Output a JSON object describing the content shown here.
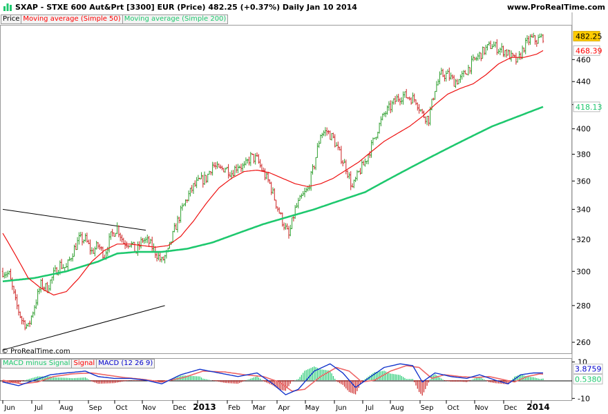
{
  "header": {
    "title": "SXAP - STXE 600 Aut&Prt [3300] EUR (Price)     482.25 (+0.37%)     Daily  Jan 10 2014",
    "site": "www.ProRealTime.com"
  },
  "copyright": "© ProRealTime.com",
  "price_legend": [
    {
      "label": "Price",
      "color": "#000000"
    },
    {
      "label": "Moving average (Simple 50)",
      "color": "#ff0000"
    },
    {
      "label": "Moving average (Simple 200)",
      "color": "#1ec86e"
    }
  ],
  "macd_legend": [
    {
      "label": "MACD minus Signal",
      "color": "#1ec86e"
    },
    {
      "label": "Signal",
      "color": "#ff0000"
    },
    {
      "label": "MACD (12 26 9)",
      "color": "#0000cc"
    }
  ],
  "chart_data": [
    {
      "type": "line",
      "subtype": "ohlc",
      "y_scale": "log",
      "ylim": [
        255,
        492
      ],
      "yticks": [
        260,
        280,
        300,
        320,
        340,
        360,
        380,
        400,
        420,
        440,
        460
      ],
      "x_labels": [
        "Jun",
        "Jul",
        "Aug",
        "Sep",
        "Oct",
        "Nov",
        "Dec",
        "2013",
        "Feb",
        "Mar",
        "Apr",
        "May",
        "Jun",
        "Jul",
        "Aug",
        "Sep",
        "Oct",
        "Nov",
        "Dec",
        "2014"
      ],
      "bold_x_labels": [
        "2013",
        "2014"
      ],
      "value_tags": [
        {
          "name": "Price",
          "value": "482.25",
          "bg": "#ffcc00",
          "fg": "#000000"
        },
        {
          "name": "Moving average (Simple 50)",
          "value": "468.39",
          "bg": "#ffffff",
          "fg": "#ff0000"
        },
        {
          "name": "Moving average (Simple 200)",
          "value": "418.13",
          "bg": "#ffffff",
          "fg": "#1ec86e"
        }
      ],
      "price_anchors": [
        [
          0,
          300
        ],
        [
          4,
          298
        ],
        [
          8,
          282
        ],
        [
          12,
          272
        ],
        [
          16,
          268
        ],
        [
          20,
          280
        ],
        [
          24,
          292
        ],
        [
          28,
          290
        ],
        [
          32,
          298
        ],
        [
          36,
          304
        ],
        [
          40,
          302
        ],
        [
          44,
          312
        ],
        [
          48,
          320
        ],
        [
          52,
          320
        ],
        [
          56,
          312
        ],
        [
          60,
          316
        ],
        [
          64,
          310
        ],
        [
          68,
          322
        ],
        [
          72,
          328
        ],
        [
          76,
          318
        ],
        [
          80,
          318
        ],
        [
          84,
          312
        ],
        [
          88,
          320
        ],
        [
          92,
          318
        ],
        [
          96,
          312
        ],
        [
          100,
          306
        ],
        [
          104,
          312
        ],
        [
          108,
          326
        ],
        [
          112,
          338
        ],
        [
          116,
          348
        ],
        [
          120,
          356
        ],
        [
          124,
          360
        ],
        [
          128,
          362
        ],
        [
          132,
          372
        ],
        [
          136,
          368
        ],
        [
          140,
          370
        ],
        [
          144,
          366
        ],
        [
          148,
          372
        ],
        [
          152,
          370
        ],
        [
          156,
          378
        ],
        [
          160,
          376
        ],
        [
          164,
          366
        ],
        [
          168,
          358
        ],
        [
          172,
          344
        ],
        [
          176,
          332
        ],
        [
          180,
          322
        ],
        [
          184,
          340
        ],
        [
          188,
          348
        ],
        [
          192,
          354
        ],
        [
          196,
          372
        ],
        [
          200,
          396
        ],
        [
          204,
          398
        ],
        [
          208,
          392
        ],
        [
          212,
          380
        ],
        [
          216,
          370
        ],
        [
          220,
          355
        ],
        [
          224,
          366
        ],
        [
          228,
          374
        ],
        [
          232,
          386
        ],
        [
          236,
          400
        ],
        [
          240,
          412
        ],
        [
          244,
          418
        ],
        [
          248,
          425
        ],
        [
          252,
          428
        ],
        [
          256,
          426
        ],
        [
          260,
          424
        ],
        [
          264,
          412
        ],
        [
          268,
          408
        ],
        [
          272,
          434
        ],
        [
          276,
          446
        ],
        [
          280,
          446
        ],
        [
          284,
          440
        ],
        [
          288,
          442
        ],
        [
          292,
          450
        ],
        [
          296,
          458
        ],
        [
          300,
          464
        ],
        [
          304,
          470
        ],
        [
          308,
          474
        ],
        [
          312,
          470
        ],
        [
          316,
          468
        ],
        [
          320,
          462
        ],
        [
          324,
          458
        ],
        [
          328,
          472
        ],
        [
          332,
          480
        ],
        [
          336,
          478
        ],
        [
          340,
          482
        ]
      ],
      "sma50_anchors": [
        [
          0,
          324
        ],
        [
          8,
          310
        ],
        [
          16,
          296
        ],
        [
          24,
          290
        ],
        [
          32,
          286
        ],
        [
          40,
          288
        ],
        [
          48,
          296
        ],
        [
          56,
          306
        ],
        [
          64,
          313
        ],
        [
          72,
          317
        ],
        [
          80,
          317
        ],
        [
          88,
          316
        ],
        [
          96,
          315
        ],
        [
          104,
          316
        ],
        [
          112,
          322
        ],
        [
          120,
          332
        ],
        [
          128,
          344
        ],
        [
          136,
          355
        ],
        [
          144,
          362
        ],
        [
          152,
          367
        ],
        [
          160,
          368
        ],
        [
          168,
          366
        ],
        [
          176,
          362
        ],
        [
          184,
          358
        ],
        [
          192,
          356
        ],
        [
          200,
          358
        ],
        [
          208,
          362
        ],
        [
          216,
          368
        ],
        [
          224,
          374
        ],
        [
          232,
          382
        ],
        [
          240,
          390
        ],
        [
          248,
          396
        ],
        [
          256,
          402
        ],
        [
          264,
          410
        ],
        [
          272,
          420
        ],
        [
          280,
          429
        ],
        [
          288,
          434
        ],
        [
          296,
          438
        ],
        [
          304,
          446
        ],
        [
          312,
          456
        ],
        [
          320,
          462
        ],
        [
          328,
          462
        ],
        [
          336,
          465
        ],
        [
          340,
          468.39
        ]
      ],
      "sma200_anchors": [
        [
          0,
          294
        ],
        [
          20,
          296
        ],
        [
          40,
          300
        ],
        [
          60,
          306
        ],
        [
          72,
          311
        ],
        [
          84,
          312
        ],
        [
          100,
          312
        ],
        [
          116,
          314
        ],
        [
          132,
          318
        ],
        [
          148,
          324
        ],
        [
          164,
          330
        ],
        [
          180,
          335
        ],
        [
          196,
          340
        ],
        [
          212,
          346
        ],
        [
          228,
          352
        ],
        [
          244,
          362
        ],
        [
          260,
          372
        ],
        [
          276,
          382
        ],
        [
          292,
          392
        ],
        [
          308,
          402
        ],
        [
          324,
          410
        ],
        [
          340,
          418.13
        ]
      ],
      "trendlines": [
        {
          "from": [
            0,
            340
          ],
          "to": [
            90,
            326
          ],
          "color": "#000000"
        },
        {
          "from": [
            0,
            256
          ],
          "to": [
            102,
            280
          ],
          "color": "#000000"
        }
      ]
    },
    {
      "type": "bar",
      "name": "MACD (12 26 9)",
      "ylim": [
        -11,
        11
      ],
      "yticks": [
        10,
        -10
      ],
      "value_tags": [
        {
          "name": "MACD (12 26 9)",
          "value": "3.8759",
          "bg": "#ffffff",
          "fg": "#0000cc"
        },
        {
          "name": "MACD minus Signal",
          "value": "0.5380",
          "bg": "#ffffff",
          "fg": "#1ec86e"
        }
      ],
      "macd_anchors": [
        [
          0,
          -1
        ],
        [
          10,
          -3
        ],
        [
          20,
          0
        ],
        [
          30,
          3
        ],
        [
          40,
          4
        ],
        [
          52,
          5
        ],
        [
          60,
          2
        ],
        [
          70,
          1
        ],
        [
          80,
          1
        ],
        [
          90,
          0
        ],
        [
          100,
          -2
        ],
        [
          112,
          3
        ],
        [
          124,
          6
        ],
        [
          136,
          4
        ],
        [
          148,
          2
        ],
        [
          160,
          4
        ],
        [
          170,
          -2
        ],
        [
          178,
          -8
        ],
        [
          186,
          -5
        ],
        [
          196,
          5
        ],
        [
          206,
          9
        ],
        [
          214,
          4
        ],
        [
          222,
          -4
        ],
        [
          230,
          1
        ],
        [
          240,
          7
        ],
        [
          250,
          9
        ],
        [
          258,
          8
        ],
        [
          264,
          -1
        ],
        [
          272,
          4
        ],
        [
          282,
          2
        ],
        [
          292,
          1
        ],
        [
          300,
          3
        ],
        [
          310,
          0
        ],
        [
          318,
          -2
        ],
        [
          326,
          3
        ],
        [
          334,
          4
        ],
        [
          340,
          4
        ]
      ],
      "signal_anchors": [
        [
          0,
          0
        ],
        [
          12,
          -2
        ],
        [
          22,
          -1
        ],
        [
          32,
          2
        ],
        [
          44,
          3.5
        ],
        [
          56,
          4
        ],
        [
          64,
          3
        ],
        [
          76,
          1.5
        ],
        [
          88,
          0.5
        ],
        [
          100,
          -1
        ],
        [
          114,
          1.5
        ],
        [
          126,
          5
        ],
        [
          140,
          4.5
        ],
        [
          152,
          3
        ],
        [
          164,
          2
        ],
        [
          174,
          -1
        ],
        [
          182,
          -6
        ],
        [
          190,
          -5
        ],
        [
          200,
          2
        ],
        [
          210,
          7
        ],
        [
          218,
          5
        ],
        [
          226,
          -1
        ],
        [
          234,
          0
        ],
        [
          244,
          5
        ],
        [
          254,
          8
        ],
        [
          262,
          7
        ],
        [
          270,
          1
        ],
        [
          278,
          3
        ],
        [
          288,
          2
        ],
        [
          298,
          1.5
        ],
        [
          306,
          2
        ],
        [
          314,
          0.5
        ],
        [
          322,
          -1
        ],
        [
          330,
          2
        ],
        [
          338,
          3.5
        ],
        [
          340,
          3.3
        ]
      ]
    }
  ]
}
